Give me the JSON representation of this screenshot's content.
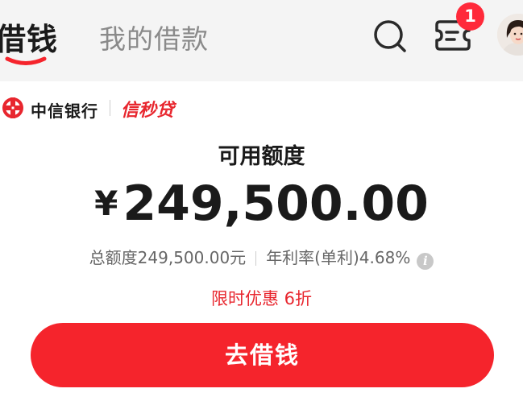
{
  "header": {
    "tabs": [
      {
        "label": "借钱",
        "active": true
      },
      {
        "label": "我的借款",
        "active": false
      }
    ],
    "message_badge_count": "1",
    "icons": [
      "search-icon",
      "message-ticket-icon",
      "avatar"
    ],
    "colors": {
      "accent": "#f5242c"
    }
  },
  "brand": {
    "bank_name": "中信银行",
    "product_name": "信秒贷"
  },
  "credit": {
    "label": "可用额度",
    "currency_symbol": "¥",
    "amount": "249,500.00",
    "total_limit_text": "总额度249,500.00元",
    "rate_text": "年利率(单利)4.68%",
    "info_icon_glyph": "i",
    "promo_text": "限时优惠 6折"
  },
  "cta": {
    "label": "去借钱"
  }
}
